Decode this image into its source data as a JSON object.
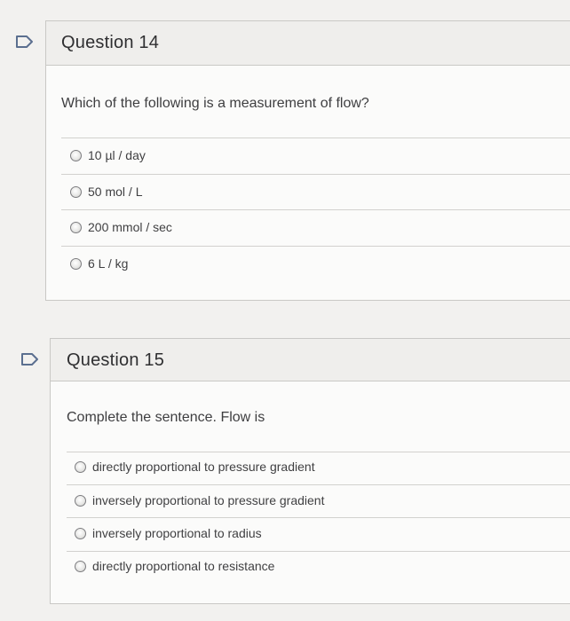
{
  "questions": [
    {
      "title": "Question 14",
      "prompt": "Which of the following is a measurement of flow?",
      "options": [
        "10 µl / day",
        "50 mol / L",
        "200 mmol / sec",
        "6 L / kg"
      ]
    },
    {
      "title": "Question 15",
      "prompt": "Complete the sentence. Flow is",
      "options": [
        "directly proportional to pressure gradient",
        "inversely proportional to pressure gradient",
        "inversely proportional to radius",
        "directly proportional to resistance"
      ]
    }
  ],
  "icons": {
    "flag": "flag-icon",
    "radio": "radio-button"
  },
  "colors": {
    "page_background": "#f2f1ef",
    "card_background": "#fbfbfa",
    "header_background": "#efeeec",
    "border": "#c9c8c5"
  }
}
